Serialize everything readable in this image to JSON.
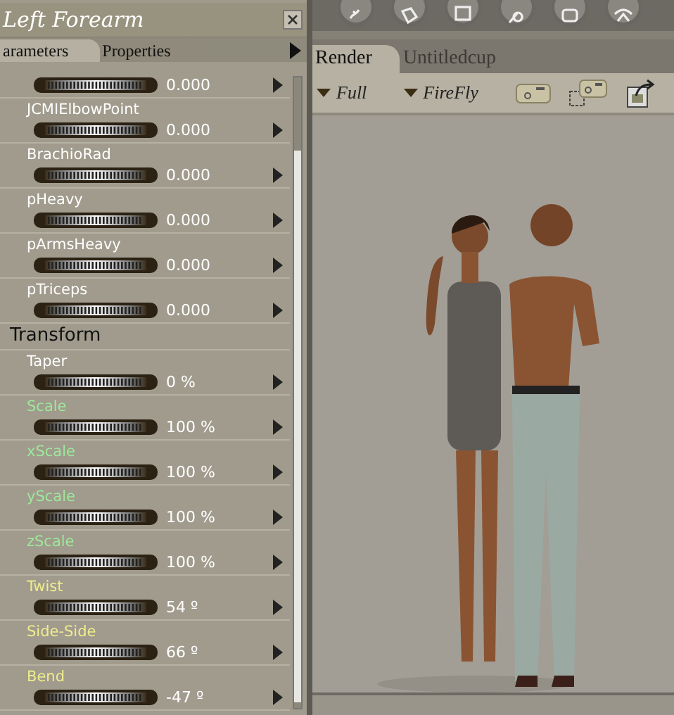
{
  "panel": {
    "title": "Left Forearm",
    "tabs": [
      {
        "label": "arameters",
        "selected": true
      },
      {
        "label": "Properties",
        "selected": false
      }
    ],
    "rows": [
      {
        "kind": "param",
        "value": "0.000"
      },
      {
        "kind": "param",
        "name": "JCMIElbowPoint",
        "value": "0.000",
        "color": "#ffffff"
      },
      {
        "kind": "param",
        "name": "BrachioRad",
        "value": "0.000",
        "color": "#ffffff"
      },
      {
        "kind": "param",
        "name": "pHeavy",
        "value": "0.000",
        "color": "#ffffff"
      },
      {
        "kind": "param",
        "name": "pArmsHeavy",
        "value": "0.000",
        "color": "#ffffff"
      },
      {
        "kind": "param",
        "name": "pTriceps",
        "value": "0.000",
        "color": "#ffffff"
      },
      {
        "kind": "group",
        "name": "Transform"
      },
      {
        "kind": "param",
        "name": "Taper",
        "value": "0 %",
        "color": "#ffffff"
      },
      {
        "kind": "param",
        "name": "Scale",
        "value": "100 %",
        "color": "#9ee89a"
      },
      {
        "kind": "param",
        "name": "xScale",
        "value": "100 %",
        "color": "#9ee89a"
      },
      {
        "kind": "param",
        "name": "yScale",
        "value": "100 %",
        "color": "#9ee89a"
      },
      {
        "kind": "param",
        "name": "zScale",
        "value": "100 %",
        "color": "#9ee89a"
      },
      {
        "kind": "param",
        "name": "Twist",
        "value": "54 º",
        "color": "#f0ec8c"
      },
      {
        "kind": "param",
        "name": "Side-Side",
        "value": "66 º",
        "color": "#f0ec8c"
      },
      {
        "kind": "param",
        "name": "Bend",
        "value": "-47 º",
        "color": "#f0ec8c"
      }
    ]
  },
  "document": {
    "tabs": [
      {
        "label": "Render",
        "selected": true
      },
      {
        "label": "Untitledcup",
        "selected": false
      }
    ],
    "options": [
      {
        "kind": "menu",
        "label": "Full"
      },
      {
        "kind": "menu",
        "label": "FireFly"
      },
      {
        "kind": "render"
      },
      {
        "kind": "area-render"
      },
      {
        "kind": "export"
      }
    ]
  }
}
